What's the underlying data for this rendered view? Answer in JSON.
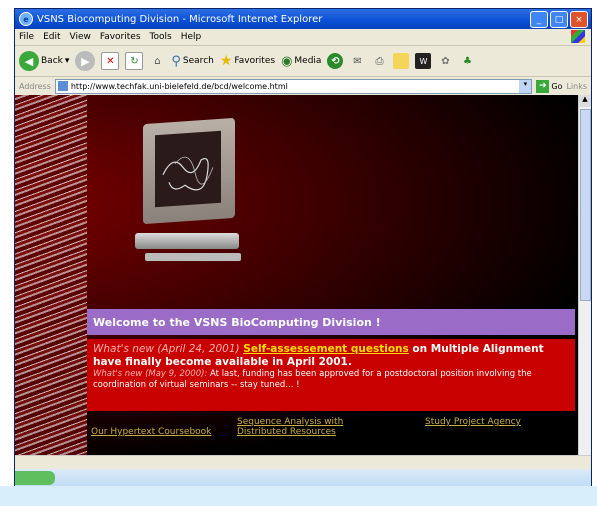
{
  "window": {
    "title": "VSNS Biocomputing Division - Microsoft Internet Explorer",
    "controls": [
      "_",
      "□",
      "×"
    ]
  },
  "menu": [
    "File",
    "Edit",
    "View",
    "Favorites",
    "Tools",
    "Help"
  ],
  "toolbar": {
    "back": "Back",
    "search": "Search",
    "favorites": "Favorites",
    "media": "Media"
  },
  "address": {
    "label": "Address",
    "url": "http://www.techfak.uni-bielefeld.de/bcd/welcome.html",
    "go": "Go",
    "links": "Links"
  },
  "page": {
    "welcome": "Welcome to the VSNS BioComputing Division !",
    "news1_date": "What's new (April 24, 2001)",
    "news1_link": "Self-assessement questions",
    "news1_rest": " on Multiple Alignment have finally become available in April 2001.",
    "news2_date": "What's new (May 9, 2000):",
    "news2_rest": " At last, funding has been approved for a postdoctoral position involving the coordination of virtual seminars -- stay tuned... !",
    "links": {
      "hypertext": "Our Hypertext Coursebook",
      "sequence": "Sequence Analysis with Distributed Resources",
      "study": "Study Project Agency"
    }
  },
  "colors": {
    "welcome_bar": "#9a6cc8",
    "news_bar": "#c80000",
    "link_yellow": "#ffe000",
    "nav_link": "#c8b040"
  }
}
